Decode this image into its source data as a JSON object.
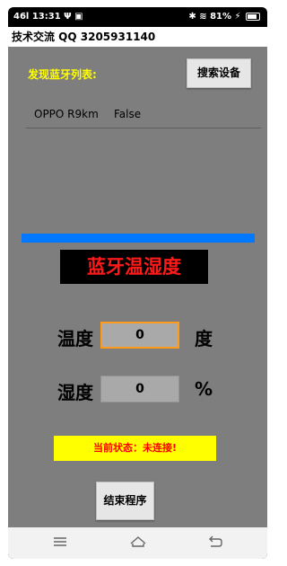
{
  "status_bar": {
    "left": "46l 13:31 Ψ ▣",
    "right": "✱ ≋ 81% ⚡",
    "battery_level": 0.81
  },
  "title_bar": {
    "title": "技术交流 QQ 3205931140"
  },
  "device_list": {
    "header": "发现蓝牙列表:",
    "scan_button": "搜索设备",
    "items": [
      {
        "name": "OPPO R9km",
        "paired": "False"
      }
    ]
  },
  "sensor": {
    "title": "蓝牙温湿度",
    "temperature_label": "温度",
    "temperature_value": "0",
    "temperature_unit": "度",
    "humidity_label": "湿度",
    "humidity_value": "0",
    "humidity_unit": "%"
  },
  "status": {
    "text": "当前状态：未连接!"
  },
  "end_button": "结束程序",
  "nav": {
    "menu_icon": "menu-icon",
    "home_icon": "home-icon",
    "back_icon": "back-icon"
  },
  "colors": {
    "app_background": "#7e7e7e",
    "accent_blue": "#0078ff",
    "title_red": "#ff1a1a",
    "status_yellow": "#ffff00",
    "header_yellow": "#ffff00"
  }
}
